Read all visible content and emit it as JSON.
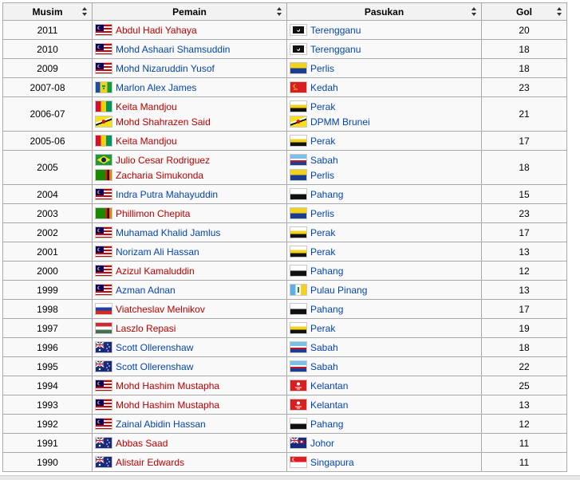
{
  "headers": {
    "season": "Musim",
    "player": "Pemain",
    "team": "Pasukan",
    "goals": "Gol"
  },
  "colors": {
    "link_red": "#ba0000",
    "link_blue": "#0645ad",
    "header_bg": "#f2f2f2",
    "border": "#aaaaaa"
  },
  "rows": [
    {
      "season": "2011",
      "goals": "20",
      "players": [
        {
          "name": "Abdul Hadi Yahaya",
          "flag": "malaysia",
          "link": "red"
        }
      ],
      "teams": [
        {
          "name": "Terengganu",
          "flag": "terengganu"
        }
      ]
    },
    {
      "season": "2010",
      "goals": "18",
      "players": [
        {
          "name": "Mohd Ashaari Shamsuddin",
          "flag": "malaysia",
          "link": "blue"
        }
      ],
      "teams": [
        {
          "name": "Terengganu",
          "flag": "terengganu"
        }
      ]
    },
    {
      "season": "2009",
      "goals": "18",
      "players": [
        {
          "name": "Mohd Nizaruddin Yusof",
          "flag": "malaysia",
          "link": "blue"
        }
      ],
      "teams": [
        {
          "name": "Perlis",
          "flag": "perlis"
        }
      ]
    },
    {
      "season": "2007-08",
      "goals": "23",
      "players": [
        {
          "name": "Marlon Alex James",
          "flag": "saint-vincent",
          "link": "blue"
        }
      ],
      "teams": [
        {
          "name": "Kedah",
          "flag": "kedah"
        }
      ]
    },
    {
      "season": "2006-07",
      "goals": "21",
      "players": [
        {
          "name": "Keita Mandjou",
          "flag": "guinea",
          "link": "red"
        },
        {
          "name": "Mohd Shahrazen Said",
          "flag": "brunei",
          "link": "red"
        }
      ],
      "teams": [
        {
          "name": "Perak",
          "flag": "perak"
        },
        {
          "name": "DPMM Brunei",
          "flag": "brunei"
        }
      ]
    },
    {
      "season": "2005-06",
      "goals": "17",
      "players": [
        {
          "name": "Keita Mandjou",
          "flag": "guinea",
          "link": "red"
        }
      ],
      "teams": [
        {
          "name": "Perak",
          "flag": "perak"
        }
      ]
    },
    {
      "season": "2005",
      "goals": "18",
      "players": [
        {
          "name": "Julio Cesar Rodriguez",
          "flag": "brazil",
          "link": "red"
        },
        {
          "name": "Zacharia Simukonda",
          "flag": "zambia",
          "link": "red"
        }
      ],
      "teams": [
        {
          "name": "Sabah",
          "flag": "sabah"
        },
        {
          "name": "Perlis",
          "flag": "perlis"
        }
      ]
    },
    {
      "season": "2004",
      "goals": "15",
      "players": [
        {
          "name": "Indra Putra Mahayuddin",
          "flag": "malaysia",
          "link": "blue"
        }
      ],
      "teams": [
        {
          "name": "Pahang",
          "flag": "pahang"
        }
      ]
    },
    {
      "season": "2003",
      "goals": "23",
      "players": [
        {
          "name": "Phillimon Chepita",
          "flag": "zambia",
          "link": "red"
        }
      ],
      "teams": [
        {
          "name": "Perlis",
          "flag": "perlis"
        }
      ]
    },
    {
      "season": "2002",
      "goals": "17",
      "players": [
        {
          "name": "Muhamad Khalid Jamlus",
          "flag": "malaysia",
          "link": "blue"
        }
      ],
      "teams": [
        {
          "name": "Perak",
          "flag": "perak"
        }
      ]
    },
    {
      "season": "2001",
      "goals": "13",
      "players": [
        {
          "name": "Norizam Ali Hassan",
          "flag": "malaysia",
          "link": "blue"
        }
      ],
      "teams": [
        {
          "name": "Perak",
          "flag": "perak"
        }
      ]
    },
    {
      "season": "2000",
      "goals": "12",
      "players": [
        {
          "name": "Azizul Kamaluddin",
          "flag": "malaysia",
          "link": "red"
        }
      ],
      "teams": [
        {
          "name": "Pahang",
          "flag": "pahang"
        }
      ]
    },
    {
      "season": "1999",
      "goals": "13",
      "players": [
        {
          "name": "Azman Adnan",
          "flag": "malaysia",
          "link": "blue"
        }
      ],
      "teams": [
        {
          "name": "Pulau Pinang",
          "flag": "penang"
        }
      ]
    },
    {
      "season": "1998",
      "goals": "17",
      "players": [
        {
          "name": "Viatcheslav Melnikov",
          "flag": "russia",
          "link": "red"
        }
      ],
      "teams": [
        {
          "name": "Pahang",
          "flag": "pahang"
        }
      ]
    },
    {
      "season": "1997",
      "goals": "19",
      "players": [
        {
          "name": "Laszlo Repasi",
          "flag": "hungary",
          "link": "red"
        }
      ],
      "teams": [
        {
          "name": "Perak",
          "flag": "perak"
        }
      ]
    },
    {
      "season": "1996",
      "goals": "18",
      "players": [
        {
          "name": "Scott Ollerenshaw",
          "flag": "australia",
          "link": "blue"
        }
      ],
      "teams": [
        {
          "name": "Sabah",
          "flag": "sabah"
        }
      ]
    },
    {
      "season": "1995",
      "goals": "22",
      "players": [
        {
          "name": "Scott Ollerenshaw",
          "flag": "australia",
          "link": "blue"
        }
      ],
      "teams": [
        {
          "name": "Sabah",
          "flag": "sabah"
        }
      ]
    },
    {
      "season": "1994",
      "goals": "25",
      "players": [
        {
          "name": "Mohd Hashim Mustapha",
          "flag": "malaysia",
          "link": "red"
        }
      ],
      "teams": [
        {
          "name": "Kelantan",
          "flag": "kelantan"
        }
      ]
    },
    {
      "season": "1993",
      "goals": "13",
      "players": [
        {
          "name": "Mohd Hashim Mustapha",
          "flag": "malaysia",
          "link": "red"
        }
      ],
      "teams": [
        {
          "name": "Kelantan",
          "flag": "kelantan"
        }
      ]
    },
    {
      "season": "1992",
      "goals": "12",
      "players": [
        {
          "name": "Zainal Abidin Hassan",
          "flag": "malaysia",
          "link": "blue"
        }
      ],
      "teams": [
        {
          "name": "Pahang",
          "flag": "pahang"
        }
      ]
    },
    {
      "season": "1991",
      "goals": "11",
      "players": [
        {
          "name": "Abbas Saad",
          "flag": "australia",
          "link": "red"
        }
      ],
      "teams": [
        {
          "name": "Johor",
          "flag": "johor"
        }
      ]
    },
    {
      "season": "1990",
      "goals": "11",
      "players": [
        {
          "name": "Alistair Edwards",
          "flag": "australia",
          "link": "red"
        }
      ],
      "teams": [
        {
          "name": "Singapura",
          "flag": "singapore"
        }
      ]
    }
  ]
}
